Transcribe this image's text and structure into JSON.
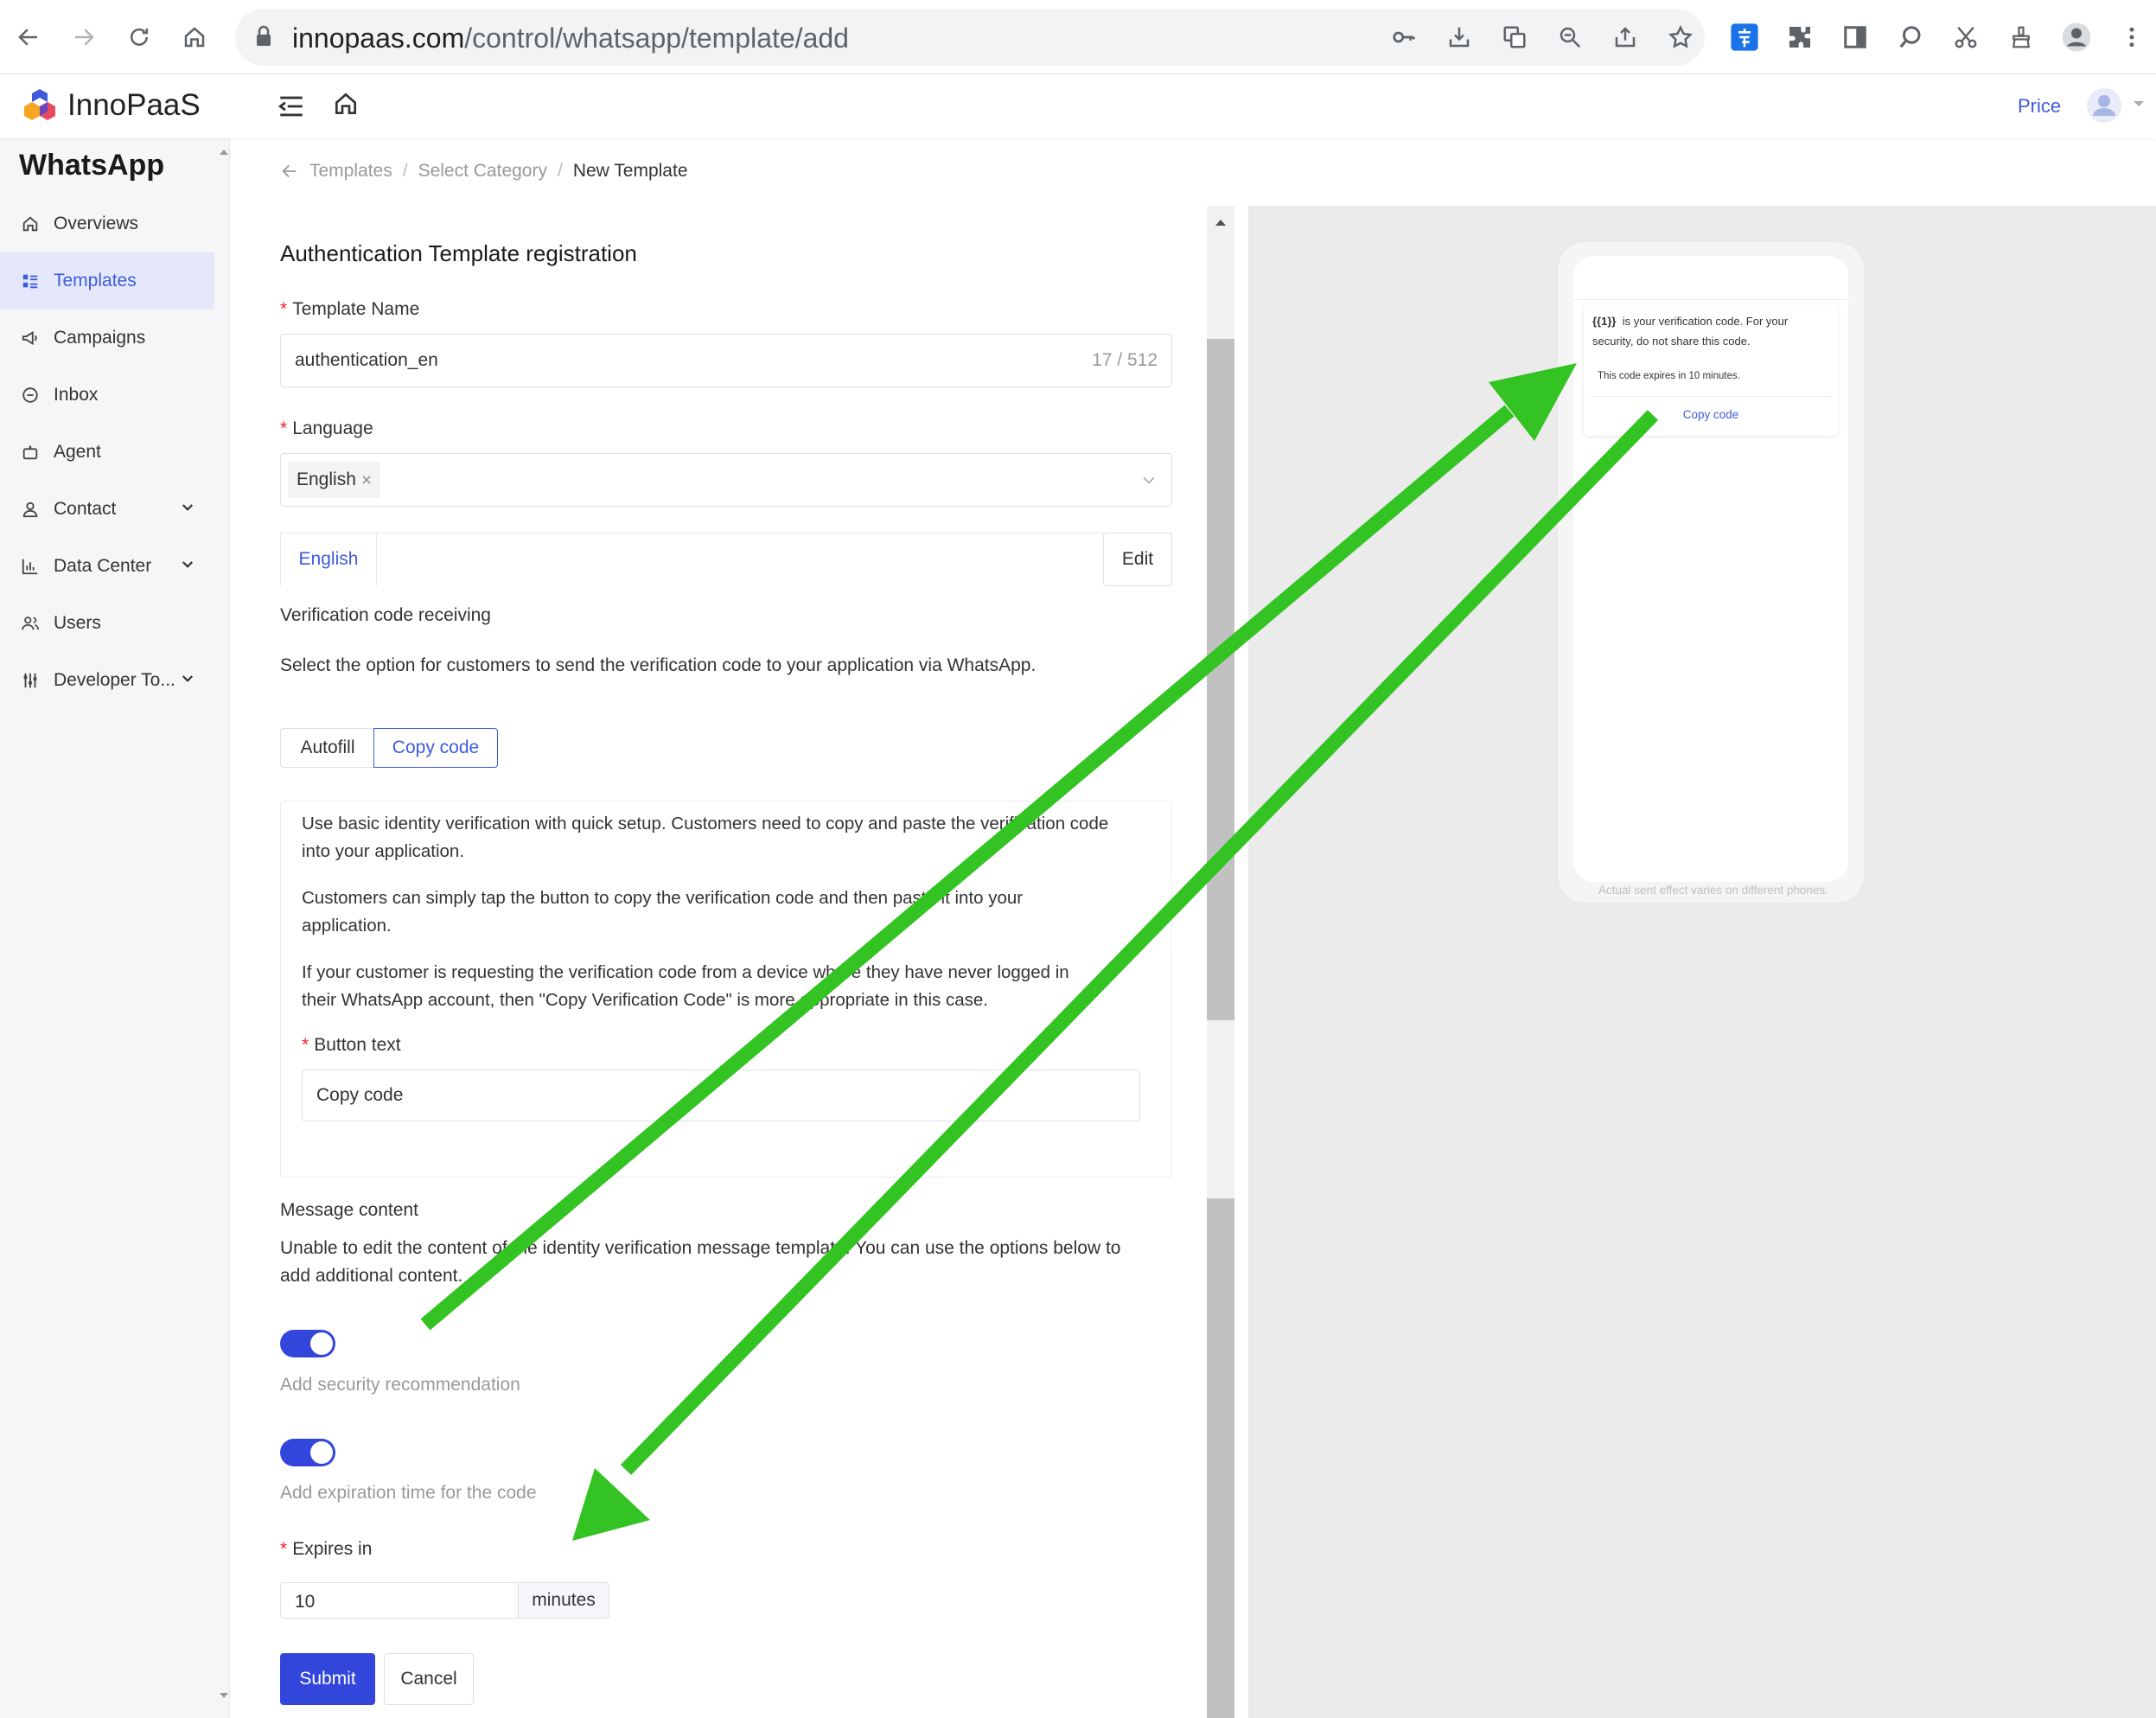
{
  "browser": {
    "url_host": "innopaas.com",
    "url_path": "/control/whatsapp/template/add"
  },
  "app": {
    "logo_text": "InnoPaaS",
    "header_price_link": "Price"
  },
  "sidebar": {
    "title": "WhatsApp",
    "items": [
      {
        "label": "Overviews"
      },
      {
        "label": "Templates"
      },
      {
        "label": "Campaigns"
      },
      {
        "label": "Inbox"
      },
      {
        "label": "Agent"
      },
      {
        "label": "Contact"
      },
      {
        "label": "Data Center"
      },
      {
        "label": "Users"
      },
      {
        "label": "Developer To..."
      }
    ]
  },
  "breadcrumb": {
    "items": [
      "Templates",
      "Select Category",
      "New Template"
    ],
    "separator": "/"
  },
  "form": {
    "title": "Authentication Template registration",
    "template_name": {
      "label": "Template Name",
      "value": "authentication_en",
      "count": "17 / 512"
    },
    "language": {
      "label": "Language",
      "tag": "English"
    },
    "lang_tab": "English",
    "edit_button": "Edit",
    "verification_heading": "Verification code receiving",
    "verification_desc": "Select the option for customers to send the verification code to your application via WhatsApp.",
    "options": {
      "autofill": "Autofill",
      "copy_code": "Copy code"
    },
    "info": {
      "p1a": "Use basic identity verification with quick setup. Customers need to copy and paste the verification code",
      "p1b": "into your application.",
      "p2a": "Customers can simply tap the button to copy the verification code and then paste it into your",
      "p2b": "application.",
      "p3a": "If your customer is requesting the verification code from a device where they have never logged in",
      "p3b": "their WhatsApp account, then \"Copy Verification Code\" is more appropriate in this case."
    },
    "button_text": {
      "label": "Button text",
      "value": "Copy code"
    },
    "message_content": {
      "label": "Message content",
      "line1": "Unable to edit the content of the identity verification message template. You can use the options below to",
      "line2": "add additional content."
    },
    "toggles": {
      "security": "Add security recommendation",
      "expiration": "Add expiration time for the code"
    },
    "expires": {
      "label": "Expires in",
      "value": "10",
      "unit": "minutes"
    },
    "submit": "Submit",
    "cancel": "Cancel"
  },
  "preview": {
    "placeholder": "{{1}}",
    "line1": "is your verification code. For your",
    "line2": "security, do not share this code.",
    "expiry": "This code expires in 10 minutes.",
    "button": "Copy code",
    "note": "Actual sent effect varies on different phones."
  },
  "colors": {
    "primary": "#3346dc",
    "link": "#3e5bdb",
    "required": "#f5222d",
    "annotation_arrow": "#33c322"
  }
}
